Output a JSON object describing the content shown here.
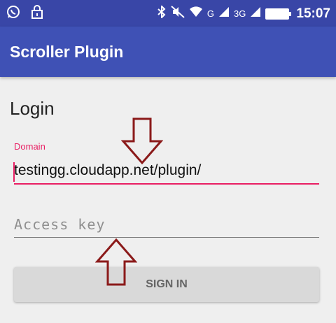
{
  "status_bar": {
    "left_icons": [
      "whatsapp-icon",
      "lock-icon"
    ],
    "right_icons": [
      "bluetooth-icon",
      "mute-icon",
      "wifi-icon",
      "signal-icon",
      "signal-3g-icon",
      "battery-icon"
    ],
    "network_g": "G",
    "network_3g": "3G",
    "time": "15:07"
  },
  "app_bar": {
    "title": "Scroller Plugin",
    "color": "#3f51b5"
  },
  "form": {
    "heading": "Login",
    "domain": {
      "label": "Domain",
      "value": "testingg.cloudapp.net/plugin/"
    },
    "access_key": {
      "placeholder": "Access key",
      "value": ""
    },
    "sign_in_label": "SIGN IN"
  },
  "annotations": {
    "arrow_color": "#8b1a1a",
    "arrows": [
      "down-arrow-annotation",
      "up-arrow-annotation"
    ]
  },
  "colors": {
    "accent": "#e91e63",
    "status_bar": "#3946a7",
    "background": "#efefef"
  }
}
